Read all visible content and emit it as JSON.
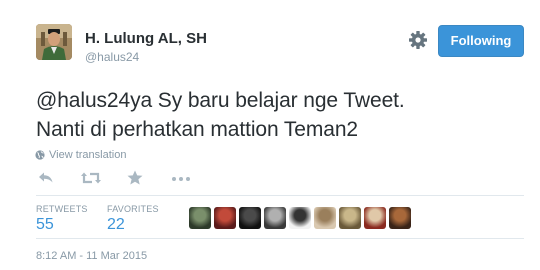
{
  "author": {
    "name": "H. Lulung AL, SH",
    "handle": "@halus24",
    "avatar_icon": "profile-photo"
  },
  "header": {
    "follow_label": "Following",
    "settings_icon": "gear-icon",
    "follow_color": "#3b94d9"
  },
  "tweet": {
    "lines": [
      "@halus24ya Sy baru belajar nge Tweet.",
      "Nanti di perhatkan mattion Teman2"
    ],
    "translate_label": "View translation"
  },
  "actions": {
    "icons": [
      "reply-icon",
      "retweet-icon",
      "favorite-icon",
      "more-icon"
    ]
  },
  "stats": {
    "retweets_label": "RETWEETS",
    "retweets_value": "55",
    "favorites_label": "FAVORITES",
    "favorites_value": "22",
    "accent_color": "#3b94d9"
  },
  "favoriters": [
    {
      "colors": [
        "#2d3a2a",
        "#7a8f6b"
      ]
    },
    {
      "colors": [
        "#5a1b1b",
        "#c24a3a"
      ]
    },
    {
      "colors": [
        "#111111",
        "#4a4a4a"
      ]
    },
    {
      "colors": [
        "#3a3a3a",
        "#b0b0b0"
      ]
    },
    {
      "colors": [
        "#f2f2f2",
        "#333333"
      ]
    },
    {
      "colors": [
        "#d9c8b0",
        "#9a7f5c"
      ]
    },
    {
      "colors": [
        "#6b5a3a",
        "#c9b78a"
      ]
    },
    {
      "colors": [
        "#8a2a1f",
        "#e0c8a8"
      ]
    },
    {
      "colors": [
        "#3a2418",
        "#a8683a"
      ]
    }
  ],
  "timestamp": "8:12 AM - 11 Mar 2015"
}
